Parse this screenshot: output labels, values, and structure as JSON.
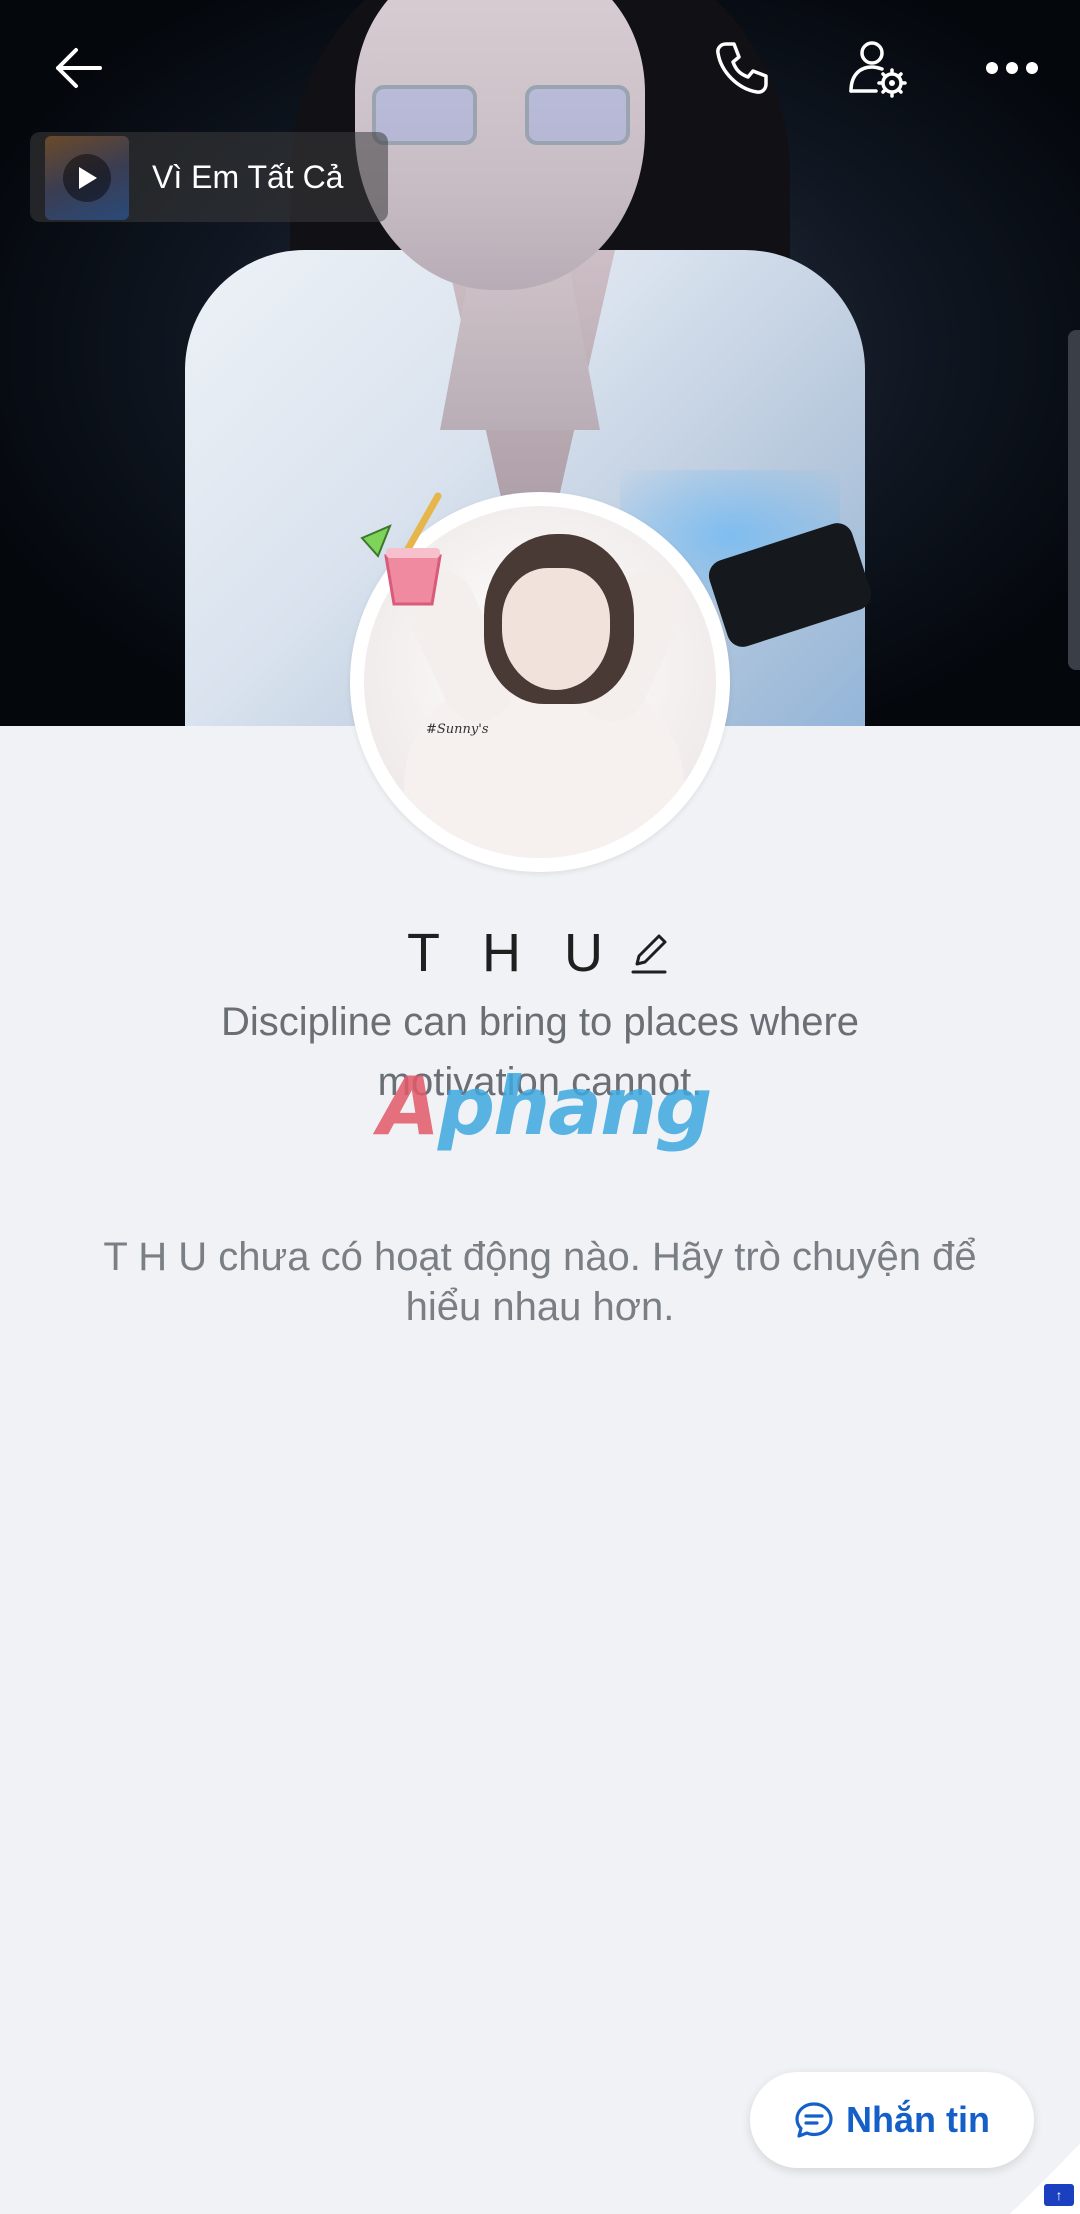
{
  "header": {
    "back_icon": "arrow-left-icon",
    "call_icon": "phone-icon",
    "settings_icon": "user-settings-icon",
    "more_icon": "more-horizontal-icon"
  },
  "music": {
    "title": "Vì Em Tất Cả",
    "play_icon": "play-icon"
  },
  "profile": {
    "name": "T H U",
    "bio": "Discipline can bring to places where motivation cannot.",
    "avatar_signature": "#Sunny's"
  },
  "watermark": {
    "part1": "A",
    "part2": "phang"
  },
  "feed": {
    "empty_message": "T H U chưa có hoạt động nào. Hãy trò chuyện để hiểu nhau hơn."
  },
  "actions": {
    "message_label": "Nhắn tin",
    "message_icon": "chat-bubble-icon"
  },
  "colors": {
    "background": "#f0f2f5",
    "accent": "#1560c8",
    "name_text": "#1f1f1f",
    "secondary_text": "#6a6e75"
  }
}
